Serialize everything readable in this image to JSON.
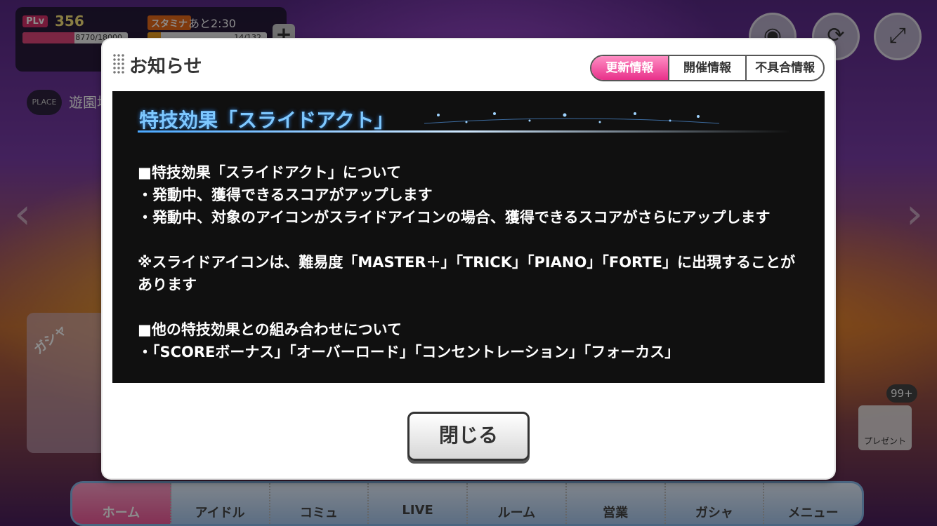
{
  "hud": {
    "plv_label": "PLv",
    "plv_value": "356",
    "exp_text": "8770/18000",
    "exp_fraction": 0.49,
    "stamina_label": "スタミナ",
    "stamina_time": "あと2:30",
    "stamina_text": "14/132",
    "stamina_fraction": 0.11,
    "plus": "+"
  },
  "place": {
    "label": "PLACE",
    "name": "遊園地"
  },
  "gacha_label": "ガシャ",
  "present": {
    "count": "99+",
    "label": "プレゼント"
  },
  "bottom_nav": [
    {
      "label": "ホーム"
    },
    {
      "label": "アイドル"
    },
    {
      "label": "コミュ"
    },
    {
      "label": "LIVE"
    },
    {
      "label": "ルーム"
    },
    {
      "label": "営業"
    },
    {
      "label": "ガシャ"
    },
    {
      "label": "メニュー"
    }
  ],
  "dialog": {
    "title": "お知らせ",
    "tabs": [
      "更新情報",
      "開催情報",
      "不具合情報"
    ],
    "content_title": "特技効果「スライドアクト」",
    "lines": [
      "■特技効果「スライドアクト」について",
      "・発動中、獲得できるスコアがアップします",
      "・発動中、対象のアイコンがスライドアイコンの場合、獲得できるスコアがさらにアップします",
      "※スライドアイコンは、難易度「MASTER＋」「TRICK」「PIANO」「FORTE」に出現することがあります",
      "■他の特技効果との組み合わせについて",
      "・「SCOREボーナス」「オーバーロード」「コンセントレーション」「フォーカス」"
    ],
    "close_label": "閉じる"
  }
}
